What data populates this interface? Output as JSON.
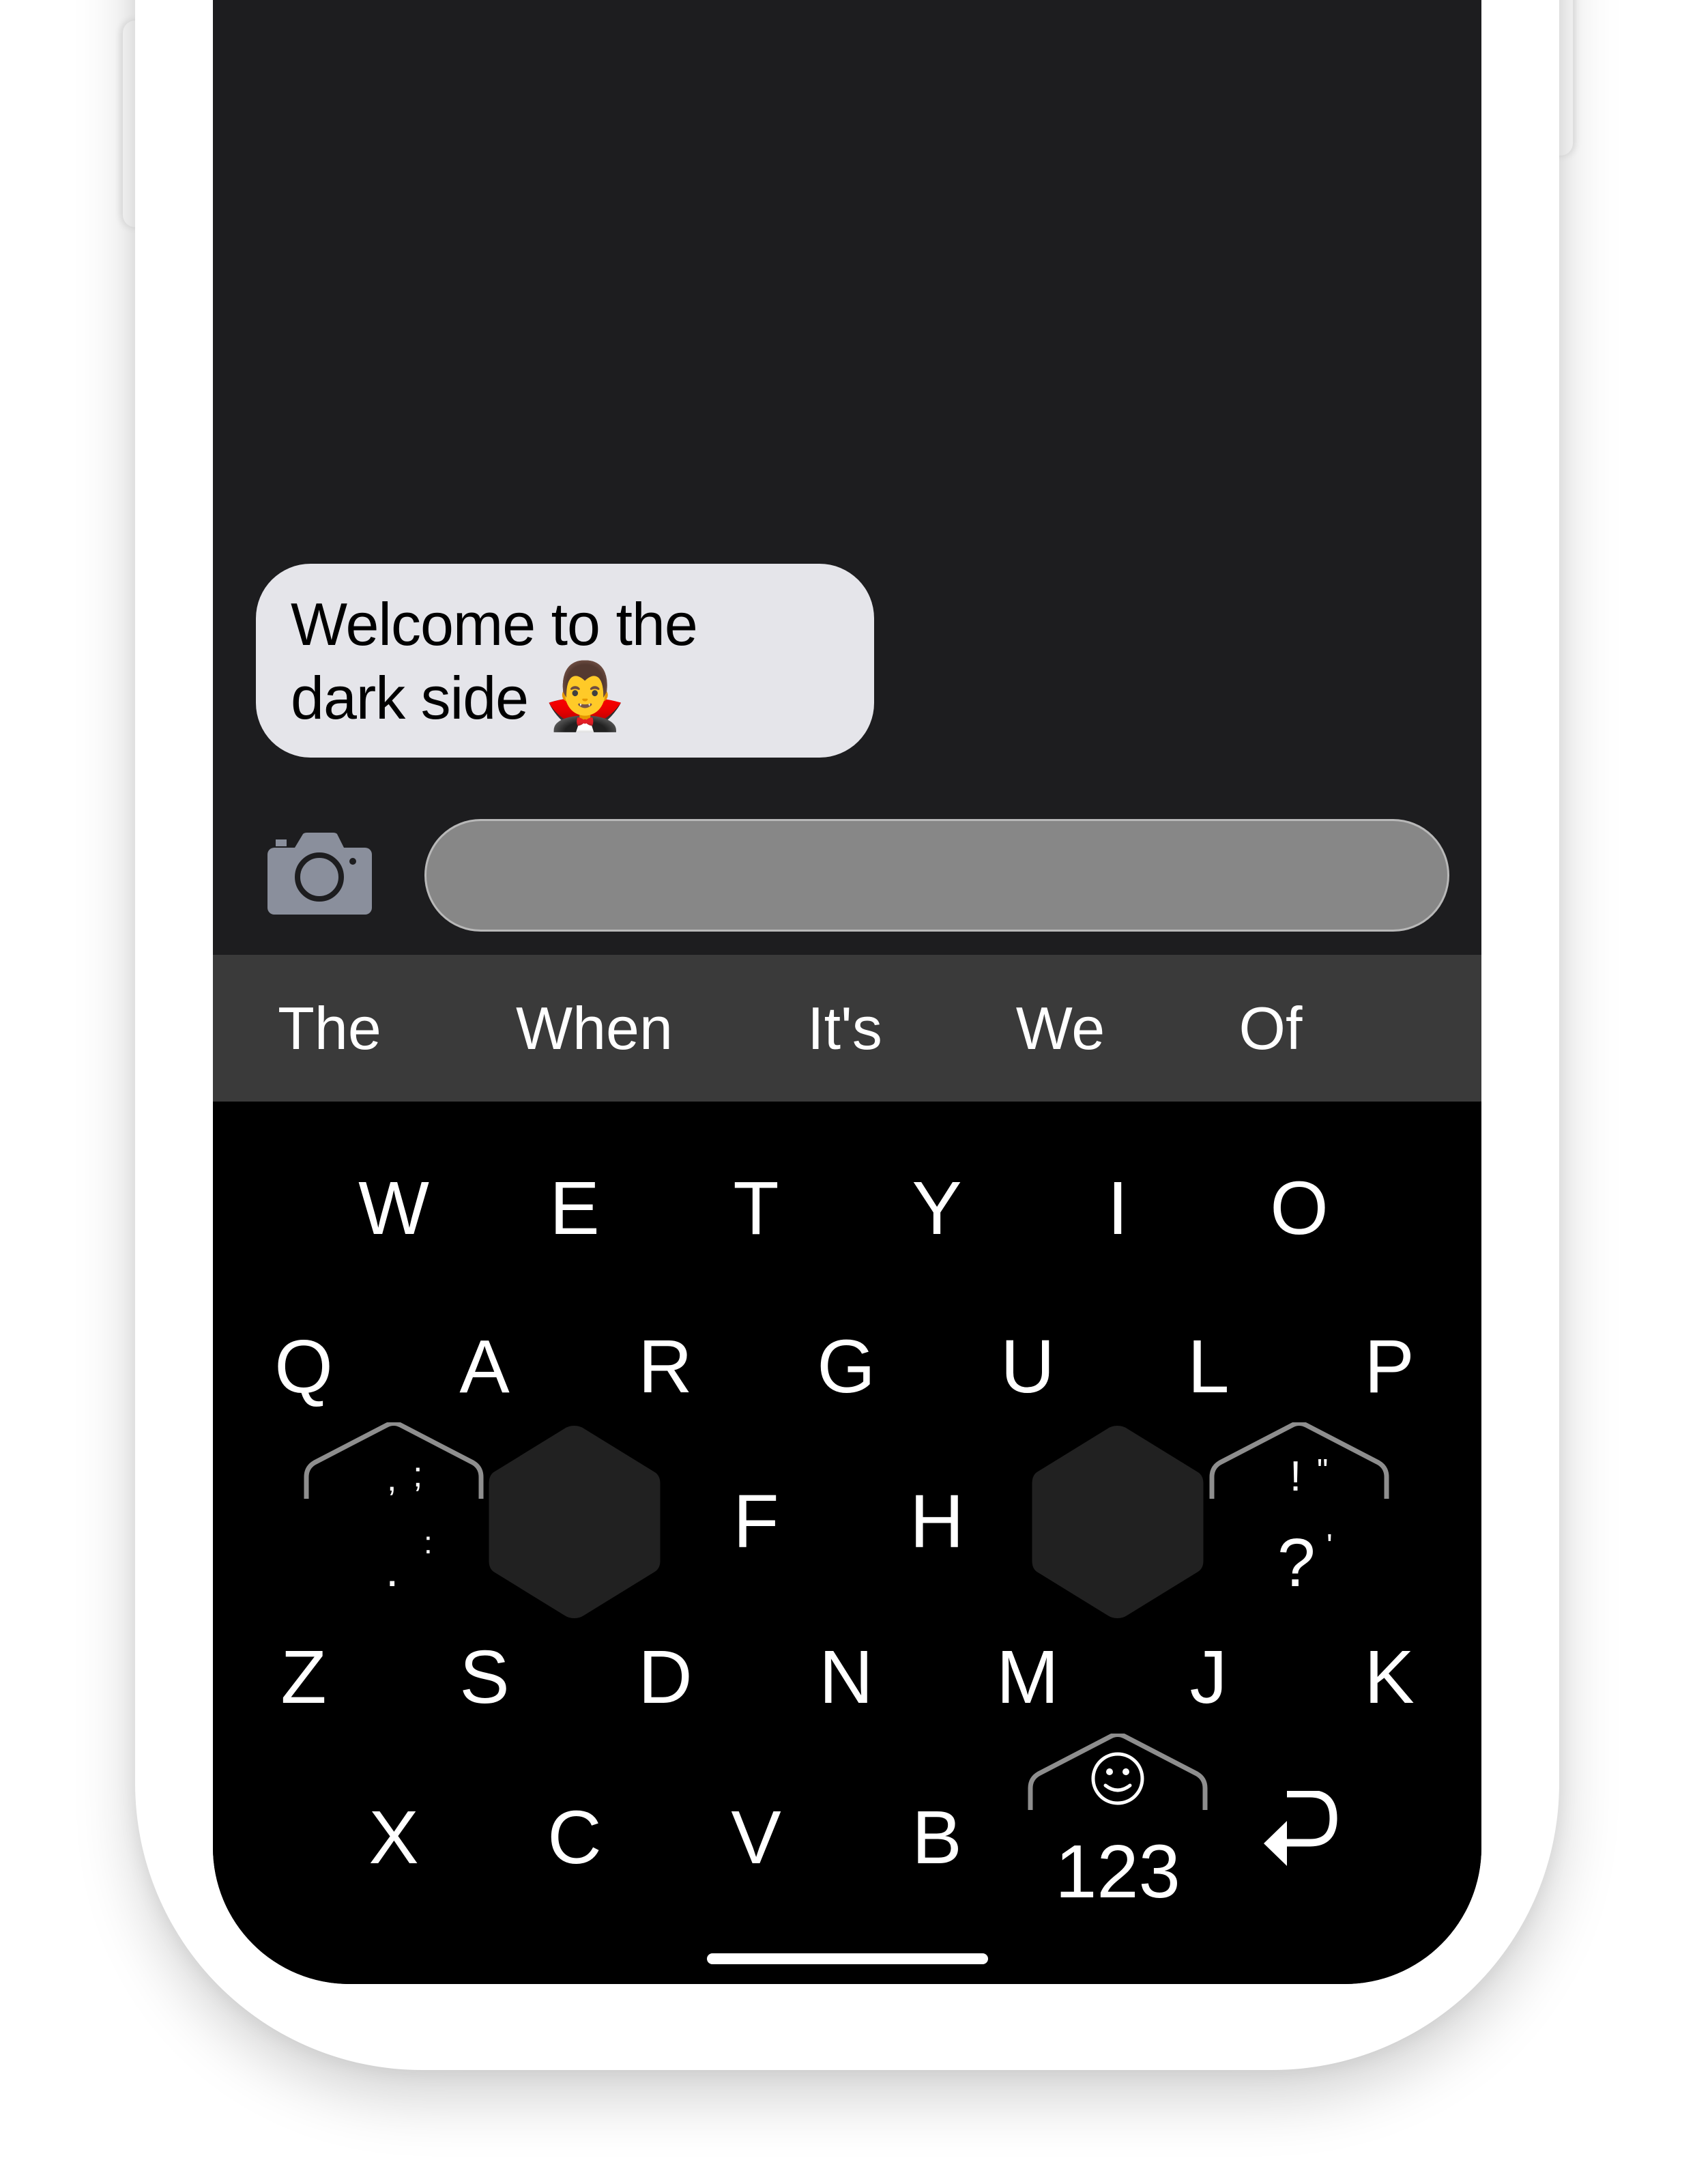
{
  "chat": {
    "message_line1": "Welcome to the",
    "message_line2": "dark side",
    "message_emoji": "🧛‍♂️",
    "bubble_color": "#e5e5ea",
    "background": "#1d1d1f"
  },
  "composer": {
    "camera_icon": "camera-icon",
    "input_value": "",
    "input_color": "#878787"
  },
  "suggestions": [
    "The",
    "When",
    "It's",
    "We",
    "Of"
  ],
  "keyboard": {
    "row1": [
      "W",
      "E",
      "T",
      "Y",
      "I",
      "O"
    ],
    "row2": [
      "Q",
      "A",
      "R",
      "G",
      "U",
      "L",
      "P"
    ],
    "row3": [
      "F",
      "H"
    ],
    "row4": [
      "Z",
      "S",
      "D",
      "N",
      "M",
      "J",
      "K"
    ],
    "row5": [
      "X",
      "C",
      "V",
      "B"
    ],
    "punct_left": {
      "top": [
        ",",
        ";"
      ],
      "bottom": [
        ":",
        "."
      ]
    },
    "punct_right": {
      "top": [
        "!",
        "\""
      ],
      "bottom": [
        "?",
        "'"
      ]
    },
    "numbers_label": "123",
    "emoji_icon": "smiley-icon",
    "return_icon": "return-icon"
  }
}
